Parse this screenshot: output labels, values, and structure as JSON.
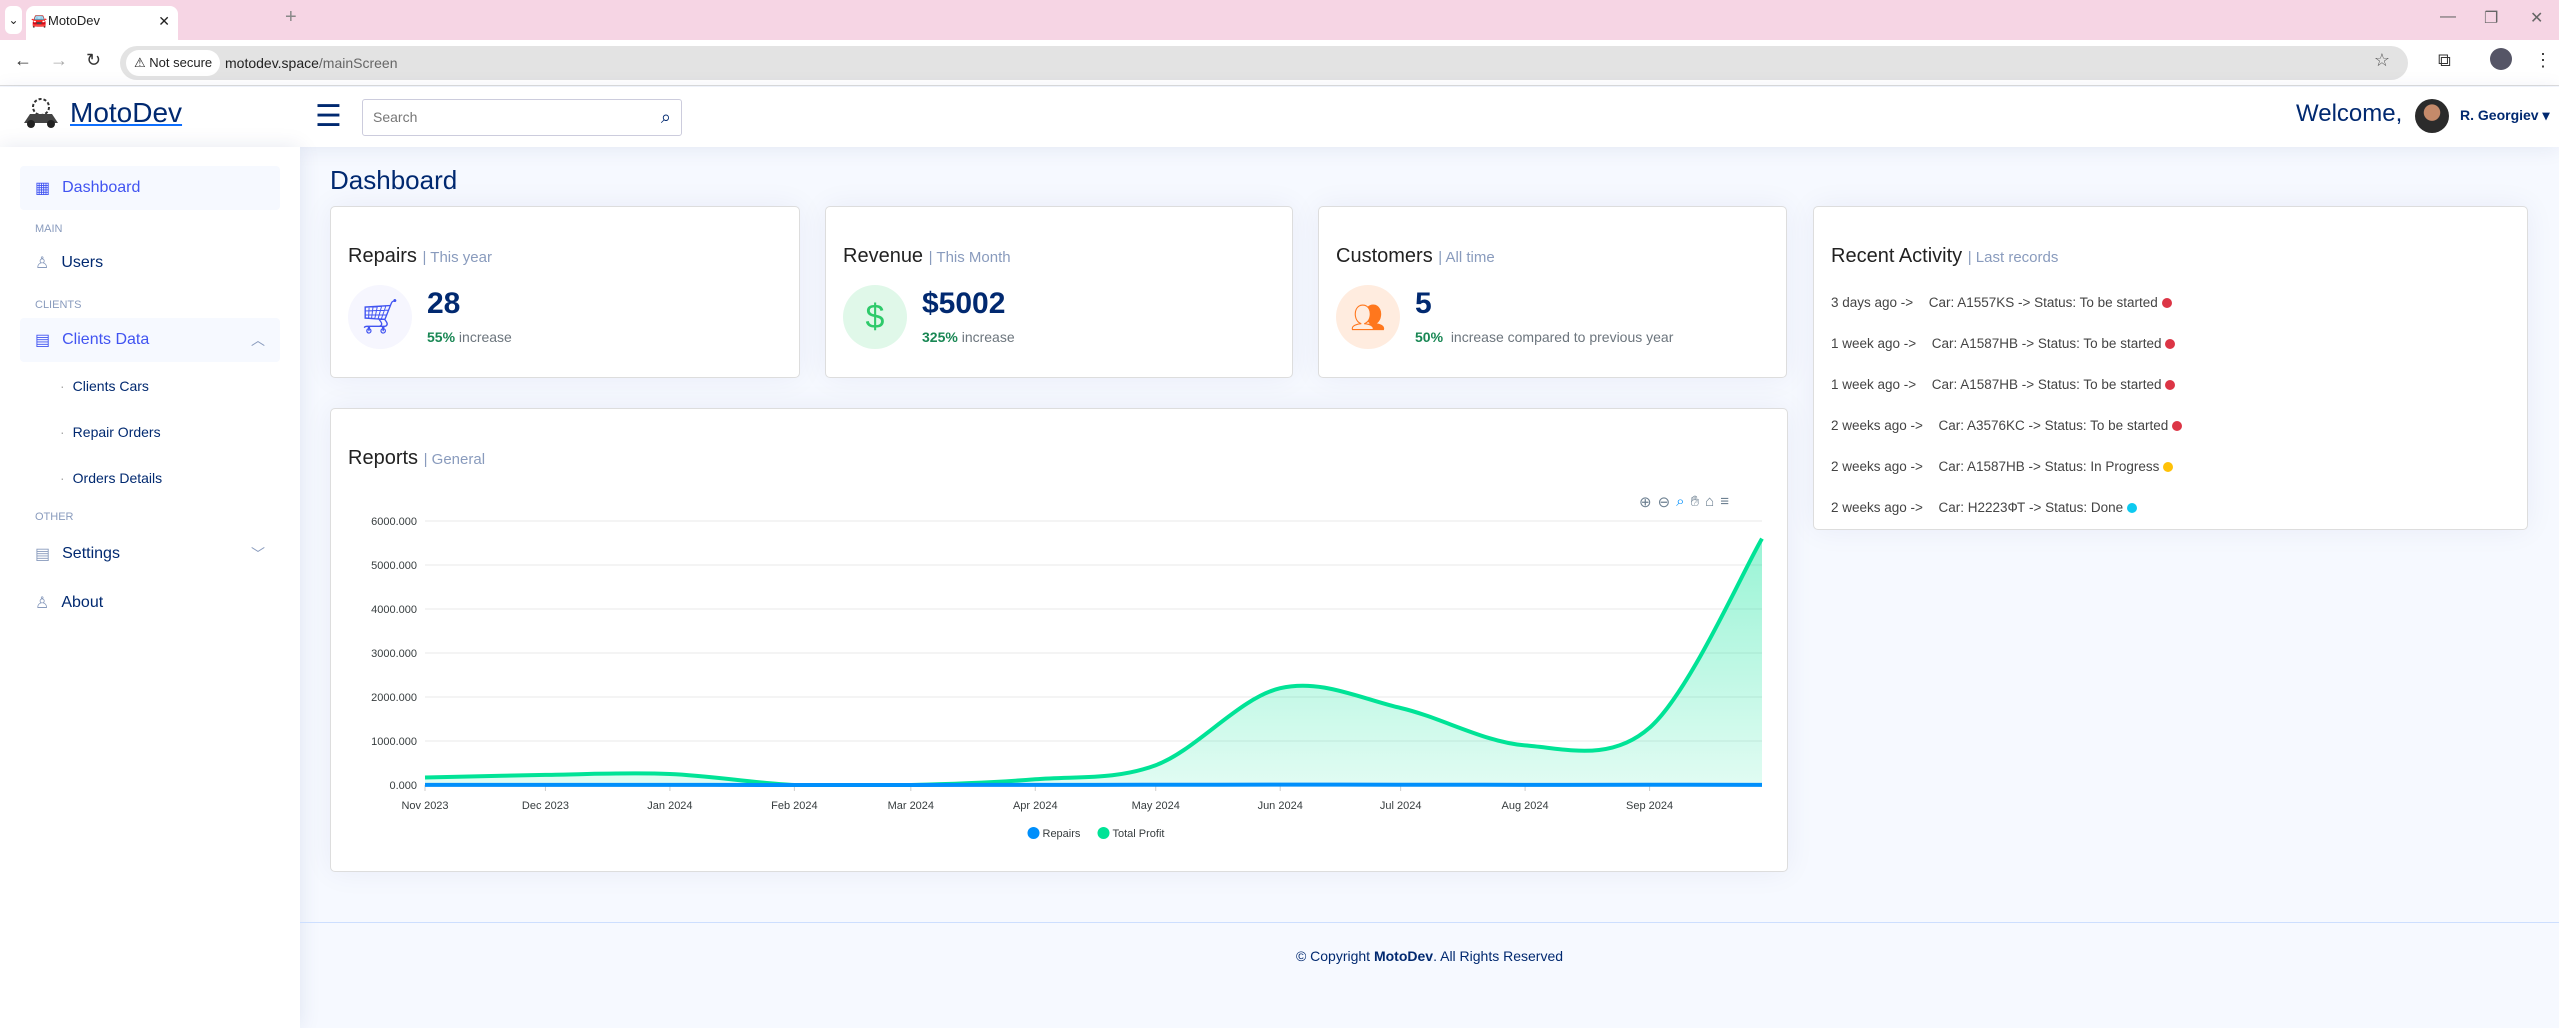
{
  "browser": {
    "tab_title": "MotoDev",
    "not_secure": "Not secure",
    "url_host": "motodev.space",
    "url_path": "/mainScreen"
  },
  "header": {
    "logo": "MotoDev",
    "search_placeholder": "Search",
    "welcome": "Welcome,",
    "user": "R. Georgiev"
  },
  "sidebar": {
    "dashboard": "Dashboard",
    "main": "MAIN",
    "users": "Users",
    "clients": "CLIENTS",
    "clients_data": "Clients Data",
    "clients_cars": "Clients Cars",
    "repair_orders": "Repair Orders",
    "orders_details": "Orders Details",
    "other": "OTHER",
    "settings": "Settings",
    "about": "About"
  },
  "page_title": "Dashboard",
  "cards": {
    "repairs": {
      "title": "Repairs",
      "period": "| This year",
      "value": "28",
      "pct": "55%",
      "note": "increase",
      "icon": "cart-icon"
    },
    "revenue": {
      "title": "Revenue",
      "period": "| This Month",
      "value": "$5002",
      "pct": "325%",
      "note": "increase",
      "icon": "dollar-icon"
    },
    "customers": {
      "title": "Customers",
      "period": "| All time",
      "value": "5",
      "pct": "50%",
      "note": "increase compared to previous year",
      "icon": "people-icon"
    }
  },
  "activity": {
    "title": "Recent Activity",
    "period": "| Last records",
    "items": [
      {
        "when": "3 days ago ->",
        "car": "Car: A1557KS -> Status: To be started",
        "color": "#dc3545"
      },
      {
        "when": "1 week ago ->",
        "car": "Car: A1587HB -> Status: To be started",
        "color": "#dc3545"
      },
      {
        "when": "1 week ago ->",
        "car": "Car: A1587HB -> Status: To be started",
        "color": "#dc3545"
      },
      {
        "when": "2 weeks ago ->",
        "car": "Car: A3576KC -> Status: To be started",
        "color": "#dc3545"
      },
      {
        "when": "2 weeks ago ->",
        "car": "Car: A1587HB -> Status: In Progress",
        "color": "#ffc107"
      },
      {
        "when": "2 weeks ago ->",
        "car": "Car: H2223ФТ -> Status: Done",
        "color": "#0dcaf0"
      }
    ]
  },
  "reports": {
    "title": "Reports",
    "period": "| General"
  },
  "chart_data": {
    "type": "area",
    "x": [
      "2023-11-01",
      "2023-12-01",
      "2024-01-01",
      "2024-02-01",
      "2024-03-01",
      "2024-04-01",
      "2024-05-01",
      "2024-06-01",
      "2024-07-01",
      "2024-08-01",
      "2024-09-01",
      "2024-09-29"
    ],
    "x_tick_labels": [
      "Nov 2023",
      "Dec 2023",
      "Jan 2024",
      "Feb 2024",
      "Mar 2024",
      "Apr 2024",
      "May 2024",
      "Jun 2024",
      "Jul 2024",
      "Aug 2024",
      "Sep 2024"
    ],
    "y_tick_labels": [
      "0.000",
      "1000.000",
      "2000.000",
      "3000.000",
      "4000.000",
      "5000.000",
      "6000.000"
    ],
    "ylim": [
      0,
      6000
    ],
    "grid": true,
    "legend": "bottom",
    "series": [
      {
        "name": "Repairs",
        "color": "#008ffb",
        "values": [
          2,
          3,
          4,
          0,
          0,
          3,
          5,
          8,
          6,
          4,
          5,
          3
        ]
      },
      {
        "name": "Total Profit",
        "color": "#00e396",
        "values": [
          170,
          230,
          250,
          0,
          0,
          130,
          450,
          2200,
          1750,
          900,
          1300,
          5600
        ]
      }
    ]
  },
  "footer": {
    "prefix": "© Copyright ",
    "brand": "MotoDev",
    "suffix": ". All Rights Reserved"
  }
}
